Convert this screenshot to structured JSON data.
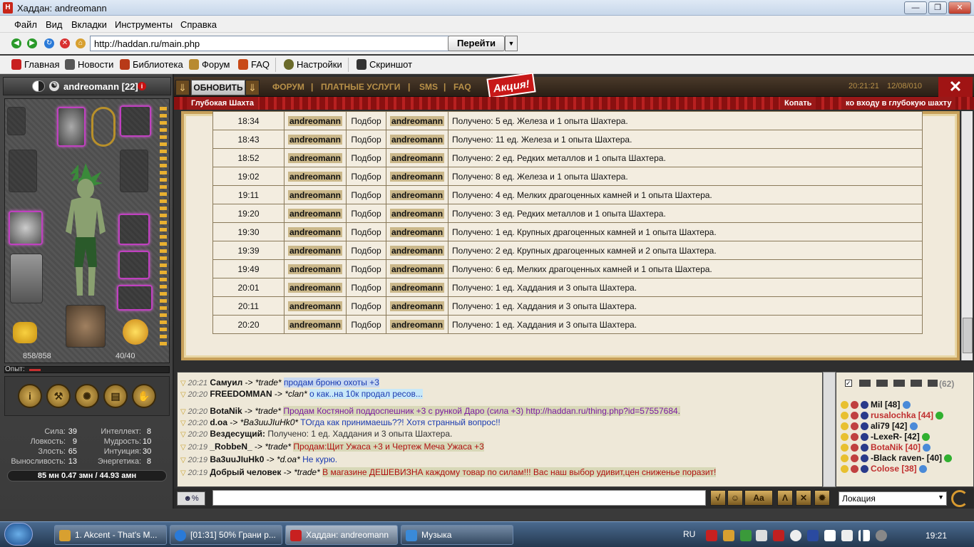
{
  "window": {
    "title": "Хаддан: andreomann"
  },
  "menu": [
    "Файл",
    "Вид",
    "Вкладки",
    "Инструменты",
    "Справка"
  ],
  "address": {
    "url": "http://haddan.ru/main.php",
    "go_label": "Перейти"
  },
  "bookmarks": [
    "Главная",
    "Новости",
    "Библиотека",
    "Форум",
    "FAQ",
    "Настройки",
    "Скриншот"
  ],
  "character": {
    "name": "andreomann [22]",
    "hp": "858/858",
    "mana": "40/40",
    "exp_label": "Опыт:"
  },
  "stats_left": [
    {
      "k": "Сила:",
      "v": "39"
    },
    {
      "k": "Ловкость:",
      "v": "9"
    },
    {
      "k": "Злость:",
      "v": "65"
    },
    {
      "k": "Выносливость:",
      "v": "13"
    }
  ],
  "stats_right": [
    {
      "k": "Интеллект:",
      "v": "8"
    },
    {
      "k": "Мудрость:",
      "v": "10"
    },
    {
      "k": "Интуиция:",
      "v": "30"
    },
    {
      "k": "Энергетика:",
      "v": "8"
    }
  ],
  "money": "85 мн  0.47 змн / 44.93 амн",
  "topbar": {
    "refresh": "ОБНОВИТЬ",
    "links": [
      "ФОРУМ",
      "|",
      "ПЛАТНЫЕ  УСЛУГИ",
      "|",
      "SMS",
      "|",
      "FAQ"
    ],
    "promo": "Акция!",
    "time": "20:21:21",
    "date": "12/08/010"
  },
  "location": {
    "name": "Глубокая Шахта",
    "action": "Копать",
    "hint": "ко входу в глубокую шахту"
  },
  "log_rows": [
    {
      "time": "18:34",
      "user": "andreomann",
      "action": "Подбор",
      "target": "andreomann",
      "msg": "Получено: 5 ед. Железа и 1 опыта Шахтера."
    },
    {
      "time": "18:43",
      "user": "andreomann",
      "action": "Подбор",
      "target": "andreomann",
      "msg": "Получено: 11 ед. Железа и 1 опыта Шахтера."
    },
    {
      "time": "18:52",
      "user": "andreomann",
      "action": "Подбор",
      "target": "andreomann",
      "msg": "Получено: 2 ед. Редких металлов и 1 опыта Шахтера."
    },
    {
      "time": "19:02",
      "user": "andreomann",
      "action": "Подбор",
      "target": "andreomann",
      "msg": "Получено: 8 ед. Железа и 1 опыта Шахтера."
    },
    {
      "time": "19:11",
      "user": "andreomann",
      "action": "Подбор",
      "target": "andreomann",
      "msg": "Получено: 4 ед. Мелких драгоценных камней и 1 опыта Шахтера."
    },
    {
      "time": "19:20",
      "user": "andreomann",
      "action": "Подбор",
      "target": "andreomann",
      "msg": "Получено: 3 ед. Редких металлов и 1 опыта Шахтера."
    },
    {
      "time": "19:30",
      "user": "andreomann",
      "action": "Подбор",
      "target": "andreomann",
      "msg": "Получено: 1 ед. Крупных драгоценных камней и 1 опыта Шахтера."
    },
    {
      "time": "19:39",
      "user": "andreomann",
      "action": "Подбор",
      "target": "andreomann",
      "msg": "Получено: 2 ед. Крупных драгоценных камней и 2 опыта Шахтера."
    },
    {
      "time": "19:49",
      "user": "andreomann",
      "action": "Подбор",
      "target": "andreomann",
      "msg": "Получено: 6 ед. Мелких драгоценных камней и 1 опыта Шахтера."
    },
    {
      "time": "20:01",
      "user": "andreomann",
      "action": "Подбор",
      "target": "andreomann",
      "msg": "Получено: 1 ед. Хаддания и 3 опыта Шахтера."
    },
    {
      "time": "20:11",
      "user": "andreomann",
      "action": "Подбор",
      "target": "andreomann",
      "msg": "Получено: 1 ед. Хаддания и 3 опыта Шахтера."
    },
    {
      "time": "20:20",
      "user": "andreomann",
      "action": "Подбор",
      "target": "andreomann",
      "msg": "Получено: 1 ед. Хаддания и 3 опыта Шахтера."
    }
  ],
  "chat": [
    {
      "ts": "20:21",
      "from": "Самуил",
      "arrow": " -> ",
      "to": "*trade*",
      "msg": "продам броню охоты +3",
      "color": "#1a3ab0",
      "bg": "#c8d8f0"
    },
    {
      "ts": "20:20",
      "from": "FREEDOMMAN",
      "arrow": " -> ",
      "to": "*clan*",
      "msg": "о как..на 10к продал ресов...",
      "color": "#1a3ab0",
      "bg": "#c8e8f8"
    },
    {
      "ts": "20:20",
      "from": "BotaNik",
      "arrow": " -> ",
      "to": "*trade*",
      "msg": "Продам Костяной поддоспешник +3 с рункой Даро (сила +3) http://haddan.ru/thing.php?id=57557684.",
      "color": "#7a1aa0",
      "bg": "#d8d8b8"
    },
    {
      "ts": "20:20",
      "from": "d.oa",
      "arrow": " -> ",
      "to": "*Ba3uuJIuHk0*",
      "msg": "TOгда как принимаешь??! Хотя странный вопрос!!",
      "color": "#1a3ab0",
      "bg": ""
    },
    {
      "ts": "20:20",
      "from": "Вездесущий:",
      "arrow": " ",
      "to": "",
      "msg": "Получено: 1 ед. Хаддания и 3 опыта Шахтера.",
      "color": "#333",
      "bg": ""
    },
    {
      "ts": "20:19",
      "from": "_RobbeN_",
      "arrow": " -> ",
      "to": "*trade*",
      "msg": "Продам:Щит Ужаса +3 и Чертеж Меча Ужаса +3",
      "color": "#b01010",
      "bg": "#d8d8b8"
    },
    {
      "ts": "20:19",
      "from": "Ba3uuJIuHk0",
      "arrow": " -> ",
      "to": "*d.oa*",
      "msg": "Не курю.",
      "color": "#1a3ab0",
      "bg": ""
    },
    {
      "ts": "20:19",
      "from": "Добрый человек",
      "arrow": " -> ",
      "to": "*trade*",
      "msg": "В магазине ДЕШЕВИЗНА каждому товар по силам!!! Вас наш выбор удивит,цен сниженье поразит!",
      "color": "#b01010",
      "bg": "#d8d8b8"
    }
  ],
  "players": {
    "count": "(62)",
    "list": [
      {
        "name": "Mil [48]",
        "color": "#111"
      },
      {
        "name": "rusalochka [44]",
        "color": "#c03030"
      },
      {
        "name": "ali79 [42]",
        "color": "#111"
      },
      {
        "name": "-LexeR- [42]",
        "color": "#111"
      },
      {
        "name": "BotaNik [40]",
        "color": "#c03030"
      },
      {
        "name": "-Black raven- [40]",
        "color": "#111"
      },
      {
        "name": "Colose [38]",
        "color": "#c03030"
      }
    ]
  },
  "location_select": "Локация",
  "taskbar": {
    "tasks": [
      "1. Akcent - That's M...",
      "[01:31] 50% Грани р...",
      "Хаддан: andreomann",
      "Музыка"
    ],
    "lang": "RU",
    "clock": "19:21"
  }
}
